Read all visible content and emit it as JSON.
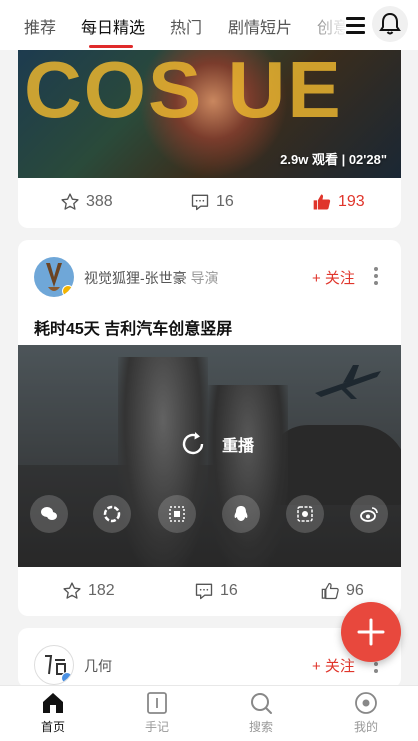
{
  "nav": {
    "tabs": [
      {
        "label": "推荐"
      },
      {
        "label": "每日精选"
      },
      {
        "label": "热门"
      },
      {
        "label": "剧情短片"
      },
      {
        "label": "创意"
      }
    ],
    "active_tab": "每日精选",
    "accent_color": "#e02a2a"
  },
  "card1": {
    "stat": "2.9w 观看  |  02'28\"",
    "favorites": "388",
    "comments": "16",
    "likes": "193"
  },
  "card2": {
    "author": "视觉狐狸-张世豪",
    "role": "导演",
    "follow": "+ 关注",
    "title": "耗时45天 吉利汽车创意竖屏",
    "replay": "重播",
    "favorites": "182",
    "comments": "16",
    "likes": "96"
  },
  "card3": {
    "author": "几何",
    "follow": "+ 关注"
  },
  "bottom_nav": {
    "items": [
      {
        "label": "首页",
        "icon": "home-icon"
      },
      {
        "label": "手记",
        "icon": "notebook-icon"
      },
      {
        "label": "搜索",
        "icon": "search-icon"
      },
      {
        "label": "我的",
        "icon": "profile-icon"
      }
    ]
  },
  "colors": {
    "red": "#e0352b",
    "fab": "#e8483d"
  }
}
